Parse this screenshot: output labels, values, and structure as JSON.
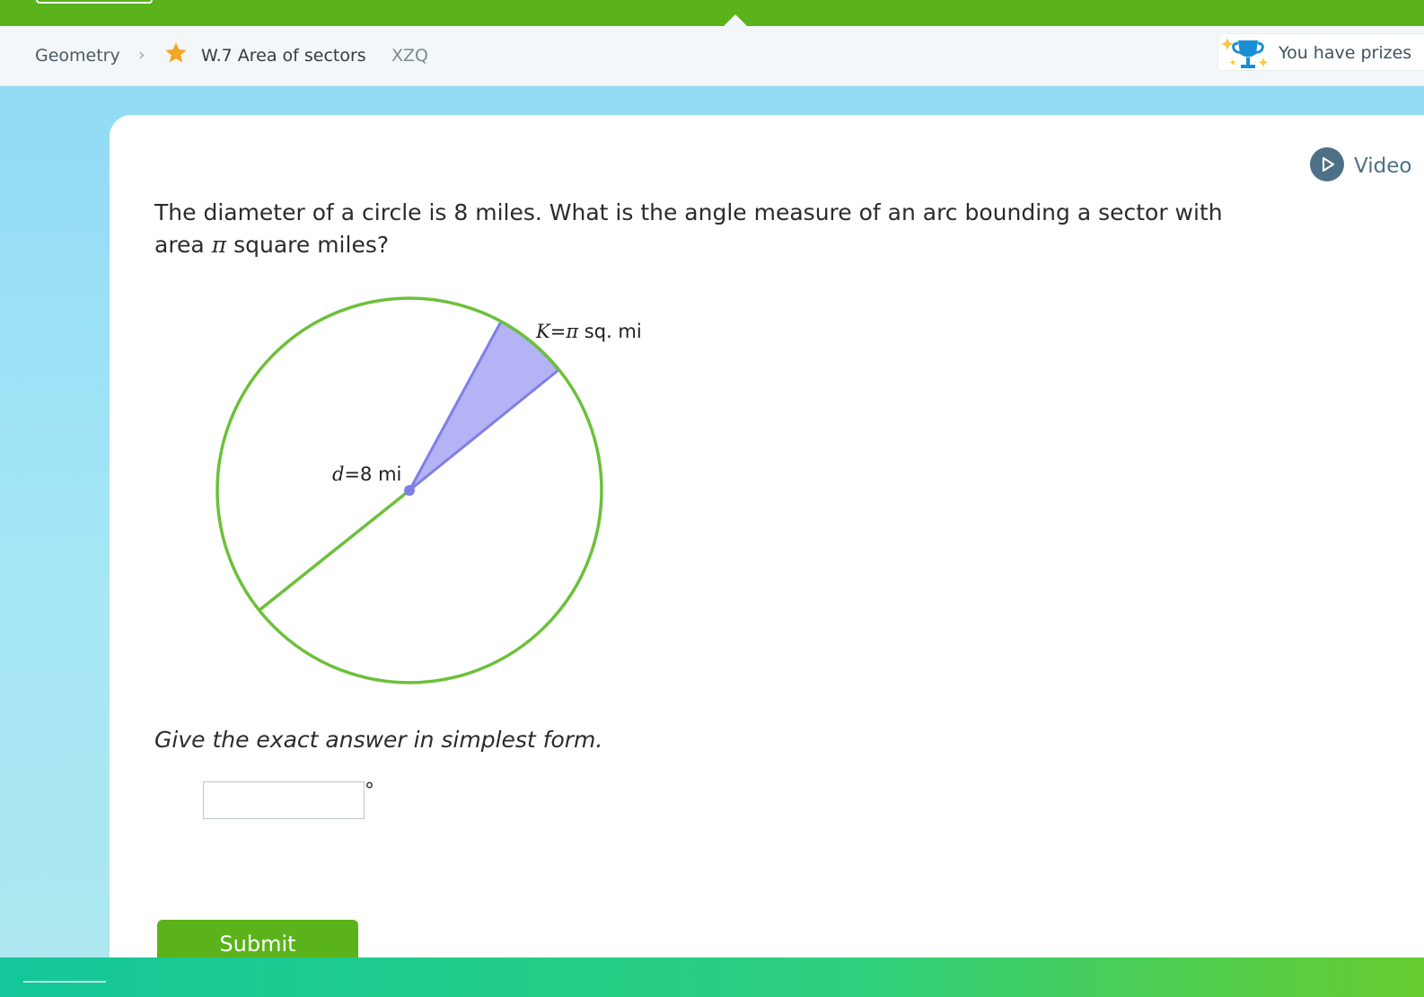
{
  "breadcrumb": {
    "subject": "Geometry",
    "skill": "W.7 Area of sectors",
    "code": "XZQ"
  },
  "prizes": {
    "label": "You have prizes"
  },
  "video": {
    "label": "Video"
  },
  "question": {
    "line_pre": "The diameter of a circle is 8 miles. What is the angle measure of an arc bounding a sector with area ",
    "pi": "π",
    "line_post": " square miles?"
  },
  "figure": {
    "sector_label_var": "K",
    "sector_label_eq": "=",
    "sector_label_pi": "π",
    "sector_label_unit": " sq. mi",
    "diameter_label_var": "d",
    "diameter_label_value": "=8 mi"
  },
  "instruction": "Give the exact answer in simplest form.",
  "answer": {
    "value": "",
    "unit": "°"
  },
  "submit": {
    "label": "Submit"
  },
  "colors": {
    "brand_green": "#5ab31a",
    "circle_green": "#6cc03a",
    "sector_fill": "#b3b3f5",
    "sector_stroke": "#7f7fe6"
  }
}
